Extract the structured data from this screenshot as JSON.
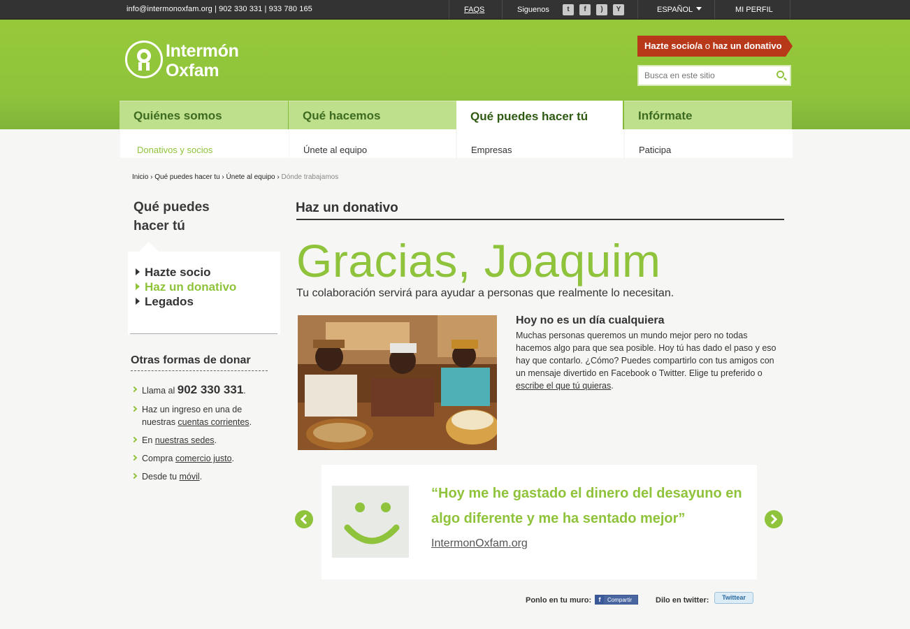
{
  "topbar": {
    "contact": "info@intermonoxfam.org  |  902 330 331  |  933 780 165",
    "faqs": "FAQS",
    "siguenos": "Siguenos",
    "social": [
      {
        "name": "twitter-icon",
        "glyph": "t"
      },
      {
        "name": "facebook-icon",
        "glyph": "f"
      },
      {
        "name": "rss-icon",
        "glyph": ")"
      },
      {
        "name": "youtube-icon",
        "glyph": "Y"
      }
    ],
    "language": "ESPAÑOL",
    "profile": "MI PERFIL"
  },
  "logo": {
    "line1": "Intermón",
    "line2": "Oxfam"
  },
  "cta": {
    "part1": "Hazte socio/a",
    "part2": " o ",
    "part3": "haz un donativo"
  },
  "search": {
    "placeholder": "Busca en este sitio"
  },
  "nav": {
    "tabs": [
      "Quiénes somos",
      "Qué hacemos",
      "Qué puedes hacer tú",
      "Infórmate"
    ],
    "sub": [
      "Donativos y socios",
      "Únete al equipo",
      "Empresas",
      "Paticipa"
    ]
  },
  "breadcrumb": {
    "items": [
      "Inicio",
      "Qué puedes hacer tu",
      "Únete al equipo"
    ],
    "current": "Dónde trabajamos"
  },
  "sidebar": {
    "title_line1": "Qué puedes",
    "title_line2": "hacer tú",
    "menu": [
      "Hazte socio",
      "Haz un donativo",
      "Legados"
    ],
    "otras_title": "Otras formas de donar",
    "otras": {
      "llama_pre": "Llama al ",
      "llama_num": "902 330 331",
      "llama_post": ".",
      "ingreso_pre": "Haz un ingreso en una de nuestras ",
      "ingreso_link": "cuentas corrientes",
      "ingreso_post": ".",
      "en_pre": "En ",
      "en_link": "nuestras sedes",
      "en_post": ".",
      "compra_pre": "Compra ",
      "compra_link": "comercio justo",
      "compra_post": ".",
      "movil_pre": "Desde tu ",
      "movil_link": "móvil",
      "movil_post": "."
    }
  },
  "main": {
    "section_title": "Haz un donativo",
    "headline": "Gracias, Joaquim",
    "subline": "Tu colaboración servirá para ayudar a personas que realmente lo necesitan.",
    "hoy_title": "Hoy no es un día cualquiera",
    "hoy_text": "Muchas personas queremos un mundo mejor pero no todas hacemos algo para que sea posible. Hoy tú has dado el paso y eso hay que contarlo. ¿Cómo? Puedes compartirlo con tus amigos con un mensaje divertido en Facebook o Twitter. Elige tu preferido o ",
    "hoy_link": "escribe el que tú quieras",
    "hoy_end": ".",
    "quote": "“Hoy me he gastado el dinero del desayuno en algo diferente y me ha sentado mejor”",
    "quote_link": "IntermonOxfam.org",
    "share_wall": "Ponlo en tu muro:",
    "fb_button": "Compartir",
    "share_twitter": "Dilo en twitter:",
    "tw_button": "Twittear"
  },
  "colors": {
    "brand_green": "#8fc33b",
    "cta_red": "#b8391a",
    "topbar": "#333333"
  }
}
